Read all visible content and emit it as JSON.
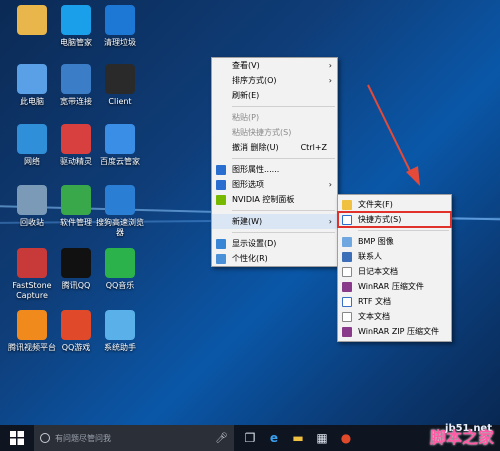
{
  "desktop": {
    "icons": [
      {
        "label": "",
        "icon": "user-folder-icon",
        "color": "#e8b64a"
      },
      {
        "label": "电脑管家",
        "icon": "shield-icon",
        "color": "#1aa0ea"
      },
      {
        "label": "清理垃圾",
        "icon": "broom-icon",
        "color": "#1c78d4"
      },
      {
        "label": "此电脑",
        "icon": "computer-icon",
        "color": "#5aa0e6"
      },
      {
        "label": "宽带连接",
        "icon": "network-icon",
        "color": "#3c7dc8"
      },
      {
        "label": "Client",
        "icon": "client-icon",
        "color": "#2a2a2a"
      },
      {
        "label": "网络",
        "icon": "globe-icon",
        "color": "#2f8fd8"
      },
      {
        "label": "驱动精灵",
        "icon": "driver-icon",
        "color": "#d84040"
      },
      {
        "label": "百度云管家",
        "icon": "cloud-icon",
        "color": "#3b8ee6"
      },
      {
        "label": "回收站",
        "icon": "recycle-bin-icon",
        "color": "#7a9ab8"
      },
      {
        "label": "软件管理",
        "icon": "pinwheel-icon",
        "color": "#38a84a"
      },
      {
        "label": "搜狗高速浏览器",
        "icon": "browser-icon",
        "color": "#2a7fd4"
      },
      {
        "label": "FastStone Capture",
        "icon": "capture-icon",
        "color": "#c83a3a"
      },
      {
        "label": "腾讯QQ",
        "icon": "penguin-icon",
        "color": "#111"
      },
      {
        "label": "QQ音乐",
        "icon": "music-icon",
        "color": "#2bb24a"
      },
      {
        "label": "腾讯视频平台",
        "icon": "video-icon",
        "color": "#f08a1c"
      },
      {
        "label": "QQ游戏",
        "icon": "game-icon",
        "color": "#e04a2a"
      },
      {
        "label": "系统助手",
        "icon": "assistant-icon",
        "color": "#5ab0e8"
      }
    ]
  },
  "context_menu": {
    "items": [
      {
        "label": "查看(V)",
        "arrow": "›"
      },
      {
        "label": "排序方式(O)",
        "arrow": "›"
      },
      {
        "label": "刷新(E)"
      },
      {
        "label": "粘贴(P)",
        "disabled": true
      },
      {
        "label": "粘贴快捷方式(S)",
        "disabled": true
      },
      {
        "label": "撤消 删除(U)",
        "shortcut": "Ctrl+Z"
      },
      {
        "label": "图形属性......",
        "icon": "graphics-icon"
      },
      {
        "label": "图形选项",
        "arrow": "›",
        "icon": "graphics-icon"
      },
      {
        "label": "NVIDIA 控制面板",
        "icon": "nvidia-icon"
      },
      {
        "label": "新建(W)",
        "arrow": "›"
      },
      {
        "label": "显示设置(D)",
        "icon": "display-icon"
      },
      {
        "label": "个性化(R)",
        "icon": "personalize-icon"
      }
    ]
  },
  "submenu": {
    "items": [
      {
        "label": "文件夹(F)",
        "icon": "folder-icon"
      },
      {
        "label": "快捷方式(S)",
        "icon": "shortcut-icon"
      },
      {
        "label": "BMP 图像",
        "icon": "bmp-icon"
      },
      {
        "label": "联系人",
        "icon": "contact-icon"
      },
      {
        "label": "日记本文档",
        "icon": "journal-icon"
      },
      {
        "label": "WinRAR 压缩文件",
        "icon": "winrar-icon"
      },
      {
        "label": "RTF 文档",
        "icon": "rtf-icon"
      },
      {
        "label": "文本文档",
        "icon": "text-doc-icon"
      },
      {
        "label": "WinRAR ZIP 压缩文件",
        "icon": "winrar-zip-icon"
      }
    ]
  },
  "taskbar": {
    "search_placeholder": "有问题尽管问我"
  },
  "watermark": {
    "text": "脚本之家",
    "url": "jb51.net"
  },
  "colors": {
    "highlight_red": "#e0322a",
    "arrow_red": "#e44a3a"
  }
}
